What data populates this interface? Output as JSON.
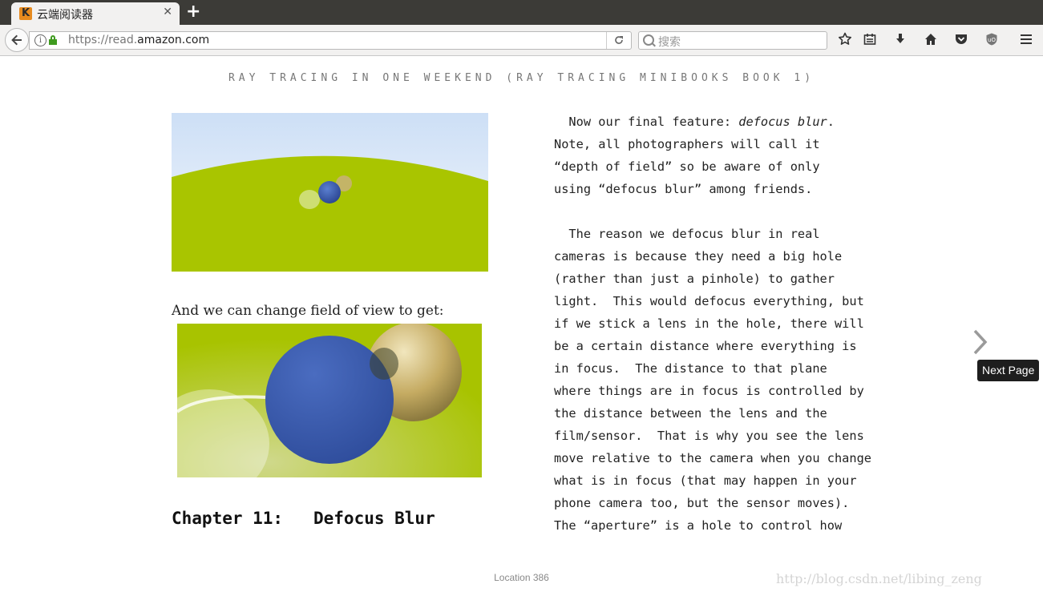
{
  "browser": {
    "tab_title": "云端阅读器",
    "tab_close": "✕",
    "new_tab": "+",
    "url_scheme": "https://read.",
    "url_domain": "amazon.com",
    "search_placeholder": "搜索",
    "favicon_letter": "K"
  },
  "reader": {
    "book_header": "RAY TRACING IN ONE WEEKEND (RAY TRACING MINIBOOKS BOOK 1)",
    "caption": "And we can change field of view to get:",
    "chapter_title": "Chapter 11:   Defocus Blur",
    "right_lines": [
      "  Now our final feature: ",
      "Note, all photographers will call it",
      "“depth of field” so be aware of only",
      "using “defocus blur” among friends.",
      "",
      "  The reason we defocus blur in real",
      "cameras is because they need a big hole",
      "(rather than just a pinhole) to gather",
      "light.  This would defocus everything, but",
      "if we stick a lens in the hole, there will",
      "be a certain distance where everything is",
      "in focus.  The distance to that plane",
      "where things are in focus is controlled by",
      "the distance between the lens and the",
      "film/sensor.  That is why you see the lens",
      "move relative to the camera when you change",
      "what is in focus (that may happen in your",
      "phone camera too, but the sensor moves).",
      "The “aperture” is a hole to control how"
    ],
    "italic_phrase": "defocus blur",
    "next_tooltip": "Next Page",
    "location": "Location 386",
    "watermark": "http://blog.csdn.net/libing_zeng"
  },
  "colors": {
    "ground_green": "#a8c400",
    "sky_blue": "#dde9f6",
    "sphere_blue": "#3f63b3",
    "sphere_gold": "#c2a85c"
  }
}
